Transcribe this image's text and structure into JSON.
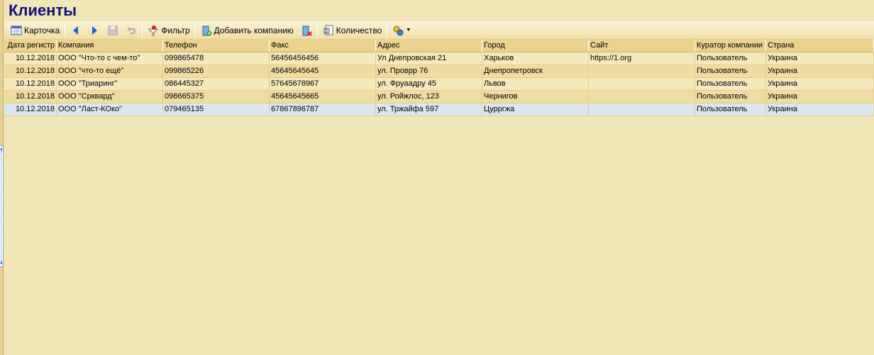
{
  "title": "Клиенты",
  "toolbar": {
    "card": "Карточка",
    "filter": "Фильтр",
    "add_company": "Добавить компанию",
    "count": "Количество"
  },
  "columns": [
    "Дата регистр",
    "Компания",
    "Телефон",
    "Факс",
    "Адрес",
    "Город",
    "Сайт",
    "Куратор компании",
    "Страна"
  ],
  "rows": [
    [
      "10.12.2018",
      "ООО \"Что-то с чем-то\"",
      "099865478",
      "56456456456",
      "Ул Днепровская 21",
      "Харьков",
      "https://1.org",
      "Пользователь",
      "Украина"
    ],
    [
      "10.12.2018",
      "ООО \"что-то ещё\"",
      "099865226",
      "45645645645",
      "ул. Проврр 76",
      "Днепропетровск",
      "",
      "Пользователь",
      "Украина"
    ],
    [
      "10.12.2018",
      "ООО \"Триаринг\"",
      "086445327",
      "57645678967",
      "ул. Фруаадру 45",
      "Львов",
      "",
      "Пользователь",
      "Украина"
    ],
    [
      "10.12.2018",
      "ООО \"Срквард\"",
      "098665375",
      "45645645665",
      "ул. Ройжлос, 123",
      "Чернигов",
      "",
      "Пользователь",
      "Украина"
    ],
    [
      "10.12.2018",
      "ООО \"Ласт-КОко\"",
      "079465135",
      "67867896787",
      "ул. Тржайфа 597",
      "Цурргжа",
      "",
      "Пользователь",
      "Украина"
    ]
  ],
  "selected_row": 4
}
